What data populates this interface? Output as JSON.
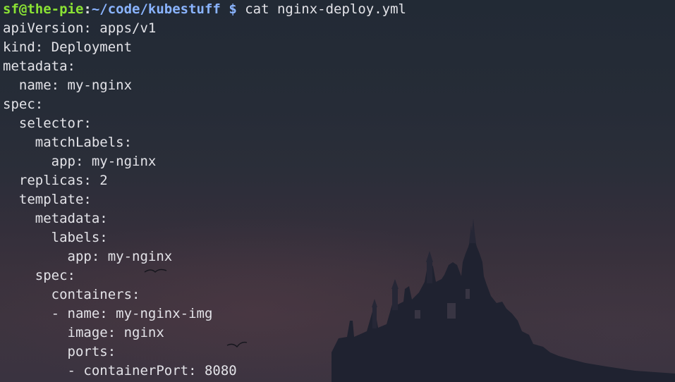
{
  "prompt": {
    "user_host": "sf@the-pie",
    "separator": ":",
    "cwd": "~/code/kubestuff",
    "symbol": "$",
    "command": " cat nginx-deploy.yml"
  },
  "output_lines": [
    "apiVersion: apps/v1",
    "kind: Deployment",
    "metadata:",
    "  name: my-nginx",
    "spec:",
    "  selector:",
    "    matchLabels:",
    "      app: my-nginx",
    "  replicas: 2",
    "  template:",
    "    metadata:",
    "      labels:",
    "        app: my-nginx",
    "    spec:",
    "      containers:",
    "      - name: my-nginx-img",
    "        image: nginx",
    "        ports:",
    "        - containerPort: 8080"
  ],
  "colors": {
    "user_host": "#8ae234",
    "path": "#8ab4ff",
    "text": "#e3e3e8",
    "background_top": "#222a35",
    "background_bottom": "#3a3340"
  },
  "background": {
    "description_icon": "castle-silhouette"
  }
}
